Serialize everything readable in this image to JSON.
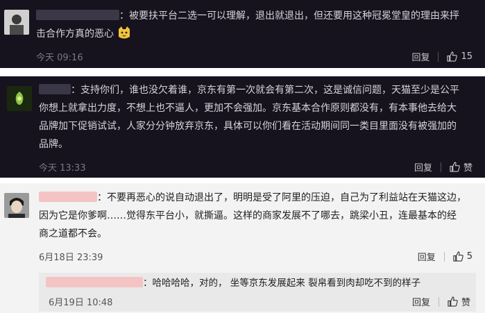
{
  "comments": [
    {
      "text_a": "：被要扶平台二选一可以理解，退出就退出，但还要用这种冠冕堂皇的理由来抨",
      "text_b": "击合作方真的恶心",
      "emoji": "cat-face-emoji",
      "time": "今天 09:16",
      "reply_label": "回复",
      "likes": "15"
    },
    {
      "text_a": "：支持你们，谁也没欠着谁，京东有第一次就会有第二次，这是诚信问题，天猫至少是公平",
      "text_b": "你想上就拿出力度，不想上也不逼人，更加不会强加。京东基本合作原则都没有，有本事他去给大",
      "text_c": "品牌加下促销试试，人家分分钟放弃京东，具体可以你们看在活动期间同一类目里面没有被强加的",
      "text_d": "品牌。",
      "time": "今天 13:33",
      "reply_label": "回复",
      "likes": "赞"
    },
    {
      "text_a": "：不要再恶心的说自动退出了，明明是受了阿里的压迫，自己为了利益站在天猫这边，",
      "text_b": "因为它是你爹啊……觉得东平台小，就撕逼。这样的商家发展不了哪去，跳梁小丑，连最基本的经",
      "text_c": "商之道都不会。",
      "time": "6月18日 23:39",
      "reply_label": "回复",
      "likes": "5",
      "reply": {
        "text": "：哈哈哈哈，对的， 坐等京东发展起来 裂帛看到肉却吃不到的样子",
        "time": "6月19日 10:48",
        "reply_label": "回复",
        "likes": "赞"
      }
    }
  ],
  "icons": {
    "like": "thumbs-up-icon"
  },
  "colors": {
    "dark_bg": "#16131e",
    "light_bg": "#f3f3f3",
    "redacted_dark": "#3a3747",
    "redacted_light": "#f4c4c4"
  }
}
